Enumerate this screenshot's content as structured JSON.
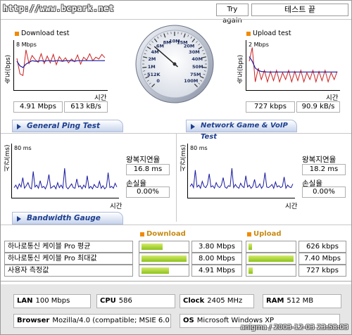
{
  "header": {
    "url": "http://www.bcpark.net",
    "try_again": "Try again",
    "status": "테스트 끝"
  },
  "download": {
    "title": "Download test",
    "ylabel": "속도(bps)",
    "scale": "8 Mbps",
    "xlabel": "시간",
    "mbps": "4.91 Mbps",
    "kbs": "613 kB/s",
    "chart_data": {
      "type": "line",
      "title": "Download test",
      "xlabel": "시간",
      "ylabel": "속도(bps)",
      "ylim": [
        0,
        8
      ],
      "series": [
        {
          "values": [
            5.3,
            2.6,
            2.3,
            6.8,
            4.4,
            5.8,
            5.1,
            4.6,
            6.1,
            4.4,
            5.7,
            4.5,
            6.0,
            4.2,
            5.6,
            4.8,
            5.4,
            4.5,
            5.2,
            4.7,
            5.9,
            4.3,
            5.5,
            5.0,
            6.1,
            4.9,
            5.5,
            5.2,
            6.0,
            5.4
          ]
        },
        {
          "values": [
            4.8,
            4.0,
            3.7,
            4.3,
            4.6,
            4.9,
            4.8,
            4.8,
            4.9,
            4.8,
            4.9,
            4.9,
            4.8,
            4.9,
            4.9,
            4.8,
            4.9,
            4.9,
            4.9,
            4.8,
            4.9,
            4.9,
            4.9,
            4.9,
            4.9,
            4.9,
            4.9,
            4.9,
            4.9,
            4.91
          ]
        }
      ]
    }
  },
  "gauge": {
    "labels": [
      "0",
      "512K",
      "1M",
      "2M",
      "4M",
      "6M",
      "8M",
      "10M",
      "15M",
      "20M",
      "30M",
      "40M",
      "50M",
      "75M",
      "100M"
    ],
    "value_mbps": 4.91
  },
  "upload": {
    "title": "Upload test",
    "ylabel": "속도(bps)",
    "scale": "2 Mbps",
    "xlabel": "시간",
    "kbps": "727 kbps",
    "kbs": "90.9 kB/s",
    "chart_data": {
      "type": "line",
      "title": "Upload test",
      "xlabel": "시간",
      "ylabel": "속도(bps)",
      "ylim": [
        0,
        2
      ],
      "series": [
        {
          "values": [
            1.2,
            1.8,
            0.3,
            0.9,
            0.4,
            0.8,
            0.3,
            0.75,
            0.35,
            0.8,
            0.3,
            0.7,
            0.4,
            0.8,
            0.3,
            0.75,
            0.35,
            0.8,
            0.3,
            0.7,
            0.4,
            0.8,
            0.3,
            0.75,
            0.35,
            0.8,
            0.3,
            0.7,
            0.4,
            0.75
          ]
        },
        {
          "values": [
            1.4,
            1.2,
            0.9,
            0.8,
            0.75,
            0.74,
            0.73,
            0.73,
            0.73,
            0.73,
            0.73,
            0.73,
            0.73,
            0.73,
            0.73,
            0.73,
            0.73,
            0.73,
            0.73,
            0.73,
            0.73,
            0.73,
            0.73,
            0.73,
            0.73,
            0.73,
            0.73,
            0.73,
            0.73,
            0.727
          ]
        }
      ]
    }
  },
  "ping": {
    "tab": "General Ping Test",
    "ylabel": "시간(ms)",
    "scale": "80 ms",
    "xlabel": "시간",
    "rtt_label": "왕복지연율",
    "rtt_value": "16.8 ms",
    "loss_label": "손실율",
    "loss_value": "0.00%",
    "chart_data": {
      "type": "line",
      "xlabel": "시간",
      "ylabel": "시간(ms)",
      "ylim": [
        0,
        80
      ],
      "series": [
        {
          "values": [
            14,
            18,
            12,
            20,
            15,
            30,
            13,
            17,
            22,
            14,
            12,
            40,
            15,
            18,
            13,
            25,
            14,
            16,
            12,
            19,
            35,
            13,
            15,
            17,
            12,
            22,
            14,
            18,
            13,
            45,
            15,
            12,
            16,
            20,
            14,
            13,
            28,
            15,
            17,
            12,
            18,
            14,
            33,
            13,
            16,
            12,
            19,
            15,
            14,
            24,
            13,
            17,
            12,
            15,
            38,
            14,
            16,
            13,
            21,
            15
          ]
        }
      ]
    }
  },
  "game": {
    "tab": "Network Game & VoIP Test",
    "ylabel": "시간(ms)",
    "scale": "80 ms",
    "xlabel": "시간",
    "rtt_label": "왕복지연율",
    "rtt_value": "18.2 ms",
    "loss_label": "손실율",
    "loss_value": "0.00%",
    "chart_data": {
      "type": "line",
      "xlabel": "시간",
      "ylabel": "시간(ms)",
      "ylim": [
        0,
        80
      ],
      "series": [
        {
          "values": [
            16,
            20,
            14,
            42,
            15,
            18,
            13,
            24,
            16,
            14,
            19,
            36,
            15,
            17,
            13,
            22,
            16,
            14,
            18,
            30,
            15,
            13,
            17,
            16,
            45,
            14,
            19,
            15,
            13,
            21,
            16,
            14,
            33,
            15,
            18,
            13,
            16,
            27,
            14,
            15,
            20,
            13,
            17,
            38,
            15,
            14,
            16,
            19,
            13,
            23,
            15,
            17,
            14,
            16,
            31,
            13,
            18,
            15,
            14,
            20
          ]
        }
      ]
    }
  },
  "bandwidth": {
    "tab": "Bandwidth Gauge",
    "download_title": "Download",
    "upload_title": "Upload",
    "rows": [
      {
        "name": "하나로통신 케이블 Pro 평균",
        "down": "3.80 Mbps",
        "down_frac": 0.475,
        "up": "626 kbps",
        "up_frac": 0.085
      },
      {
        "name": "하나로통신 케이블 Pro 최대값",
        "down": "8.00 Mbps",
        "down_frac": 1.0,
        "up": "7.40 Mbps",
        "up_frac": 1.0
      },
      {
        "name": "사용자 측정값",
        "down": "4.91 Mbps",
        "down_frac": 0.61,
        "up": "727 kbps",
        "up_frac": 0.1
      }
    ]
  },
  "system": {
    "lan_label": "LAN",
    "lan_value": "100 Mbps",
    "cpu_label": "CPU",
    "cpu_value": "586",
    "clock_label": "Clock",
    "clock_value": "2405 MHz",
    "ram_label": "RAM",
    "ram_value": "512 MB",
    "browser_label": "Browser",
    "browser_value": "Mozilla/4.0 (compatible; MSIE 6.0",
    "os_label": "OS",
    "os_value": "Microsoft Windows XP"
  },
  "footer": "anigma / 2003-12-03 23:58:03",
  "colors": {
    "red": "#cc2222",
    "blue": "#1a1aa0",
    "orange": "#f08a00",
    "tab_text": "#1d3f8f"
  }
}
